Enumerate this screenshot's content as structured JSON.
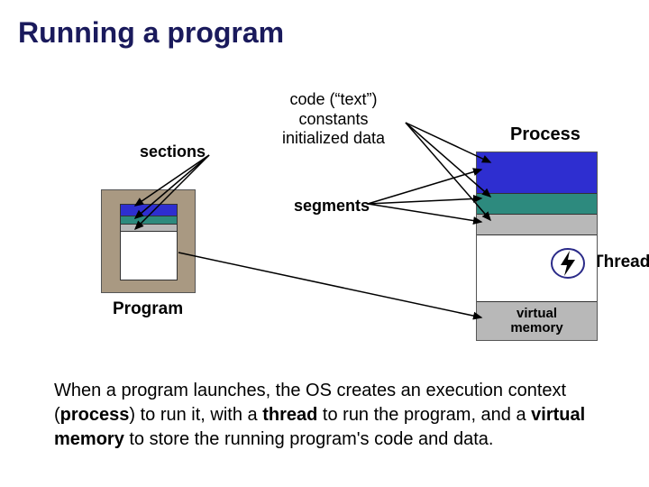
{
  "title": "Running a program",
  "labels": {
    "sections": "sections",
    "code_lines": [
      "code (“text”)",
      "constants",
      "initialized data"
    ],
    "process": "Process",
    "segments": "segments",
    "thread": "Thread",
    "program": "Program",
    "virtual_memory_l1": "virtual",
    "virtual_memory_l2": "memory"
  },
  "body": {
    "t1": "When a program launches, the OS creates an execution context (",
    "t2": "process",
    "t3": ") to run it, with a ",
    "t4": "thread",
    "t5": " to run the program, and a ",
    "t6": "virtual memory",
    "t7": " to store the running program's code and data."
  },
  "program_bands": [
    {
      "height": "16%",
      "bg": "#2e2ed0"
    },
    {
      "height": "10%",
      "bg": "#2d8a7e"
    },
    {
      "height": "10%",
      "bg": "#b8b8b8"
    },
    {
      "height": "64%",
      "bg": "#ffffff"
    }
  ],
  "process_bands": [
    {
      "height": "22%",
      "bg": "#2e2ed0"
    },
    {
      "height": "11%",
      "bg": "#2d8a7e"
    },
    {
      "height": "11%",
      "bg": "#b8b8b8"
    },
    {
      "height": "36%",
      "bg": "#ffffff"
    },
    {
      "height": "20%",
      "bg": "#b8b8b8"
    }
  ],
  "colors": {
    "title": "#1a1a5c",
    "box_bg": "#a99982",
    "oval_stroke": "#2a2a88"
  }
}
